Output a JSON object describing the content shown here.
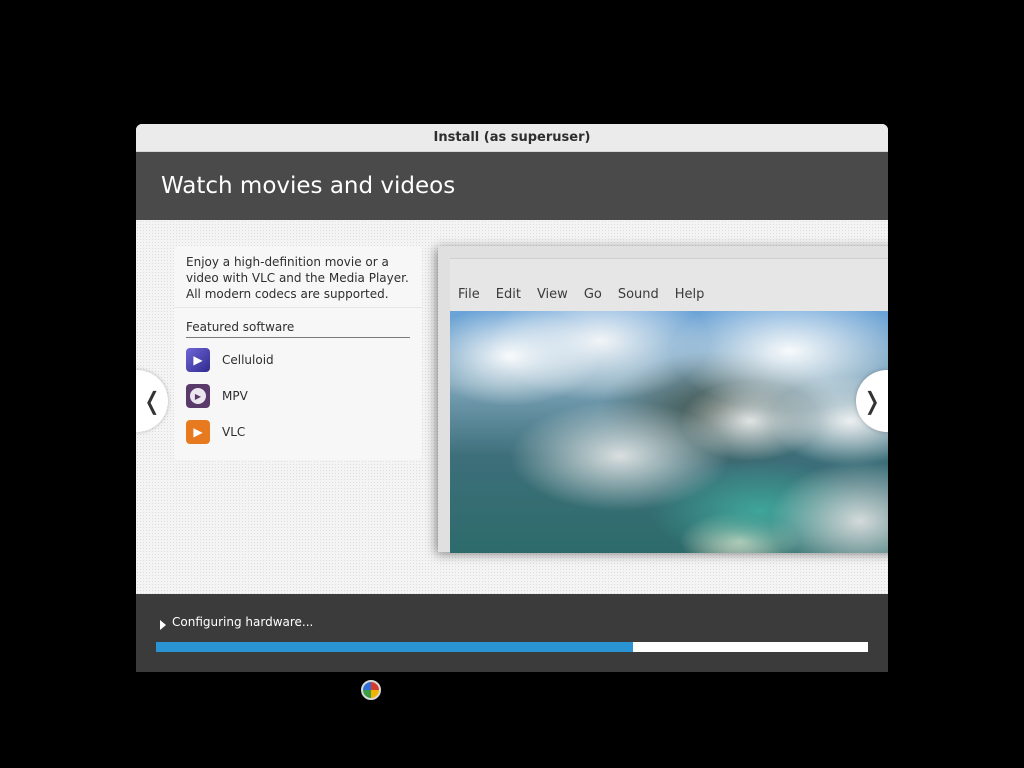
{
  "window": {
    "title": "Install (as superuser)"
  },
  "banner": {
    "title": "Watch movies and videos"
  },
  "slide": {
    "description": "Enjoy a high-definition movie or a video with VLC and the Media Player. All modern codecs are supported.",
    "featured_title": "Featured software",
    "software": [
      {
        "name": "Celluloid",
        "icon": "celluloid-icon"
      },
      {
        "name": "MPV",
        "icon": "mpv-icon"
      },
      {
        "name": "VLC",
        "icon": "vlc-icon"
      }
    ],
    "player_menu": [
      "File",
      "Edit",
      "View",
      "Go",
      "Sound",
      "Help"
    ],
    "prev_glyph": "❬",
    "next_glyph": "❭"
  },
  "status": {
    "text": "Configuring hardware...",
    "progress_percent": 67
  },
  "colors": {
    "accent": "#2a93d3",
    "banner": "#4a4a4a",
    "status_bg": "#3b3b3b"
  }
}
